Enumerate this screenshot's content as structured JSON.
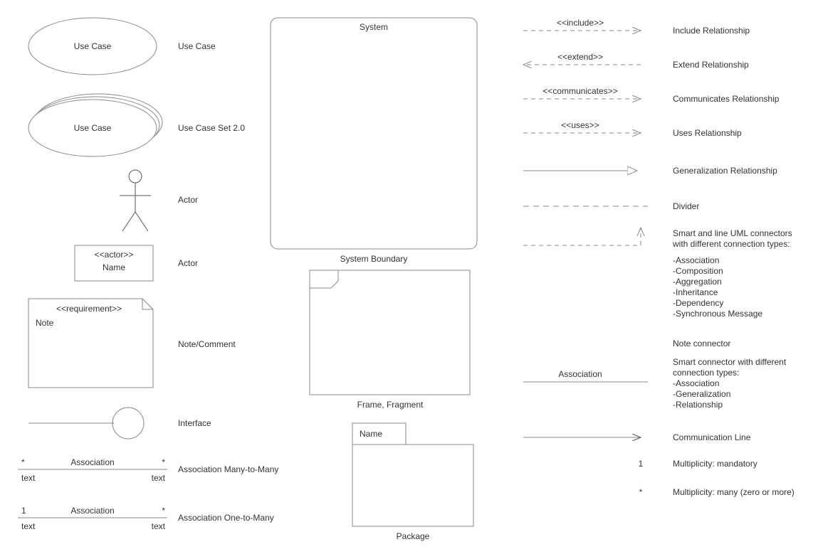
{
  "col1": {
    "use_case": {
      "shape": "Use Case",
      "label": "Use Case"
    },
    "use_case_set": {
      "shape": "Use Case",
      "label": "Use Case Set 2.0"
    },
    "actor_stick": {
      "label": "Actor"
    },
    "actor_box": {
      "stereotype": "<<actor>>",
      "name": "Name",
      "label": "Actor"
    },
    "note": {
      "stereotype": "<<requirement>>",
      "body": "Note",
      "label": "Note/Comment"
    },
    "interface": {
      "label": "Interface"
    },
    "assoc_mm": {
      "top": "Association",
      "left_mult": "*",
      "right_mult": "*",
      "left_role": "text",
      "right_role": "text",
      "label": "Association Many-to-Many"
    },
    "assoc_om": {
      "top": "Association",
      "left_mult": "1",
      "right_mult": "*",
      "left_role": "text",
      "right_role": "text",
      "label": "Association One-to-Many"
    }
  },
  "col2": {
    "system": {
      "title": "System",
      "label": "System Boundary"
    },
    "frame": {
      "label": "Frame, Fragment"
    },
    "package": {
      "name": "Name",
      "label": "Package"
    }
  },
  "col3": {
    "include": {
      "stereo": "<<include>>",
      "label": "Include Relationship"
    },
    "extend": {
      "stereo": "<<extend>>",
      "label": "Extend Relationship"
    },
    "communicates": {
      "stereo": "<<communicates>>",
      "label": "Communicates Relationship"
    },
    "uses": {
      "stereo": "<<uses>>",
      "label": "Uses Relationship"
    },
    "generalization": {
      "label": "Generalization Relationship"
    },
    "divider": {
      "label": "Divider"
    },
    "smart": {
      "label_l1": "Smart and line UML connectors",
      "label_l2": "with different connection types:",
      "types": [
        "-Association",
        "-Composition",
        "-Aggregation",
        "-Inheritance",
        "-Dependency",
        "-Synchronous Message"
      ]
    },
    "note_conn": {
      "label": "Note connector"
    },
    "assoc_conn": {
      "top": "Association",
      "label_l1": "Smart connector with different",
      "label_l2": "connection types:",
      "types": [
        "-Association",
        "-Generalization",
        "-Relationship"
      ]
    },
    "comm_line": {
      "label": "Communication Line"
    },
    "mult_mandatory": {
      "symbol": "1",
      "label": "Multiplicity: mandatory"
    },
    "mult_many": {
      "symbol": "*",
      "label": "Multiplicity: many (zero or more)"
    }
  }
}
